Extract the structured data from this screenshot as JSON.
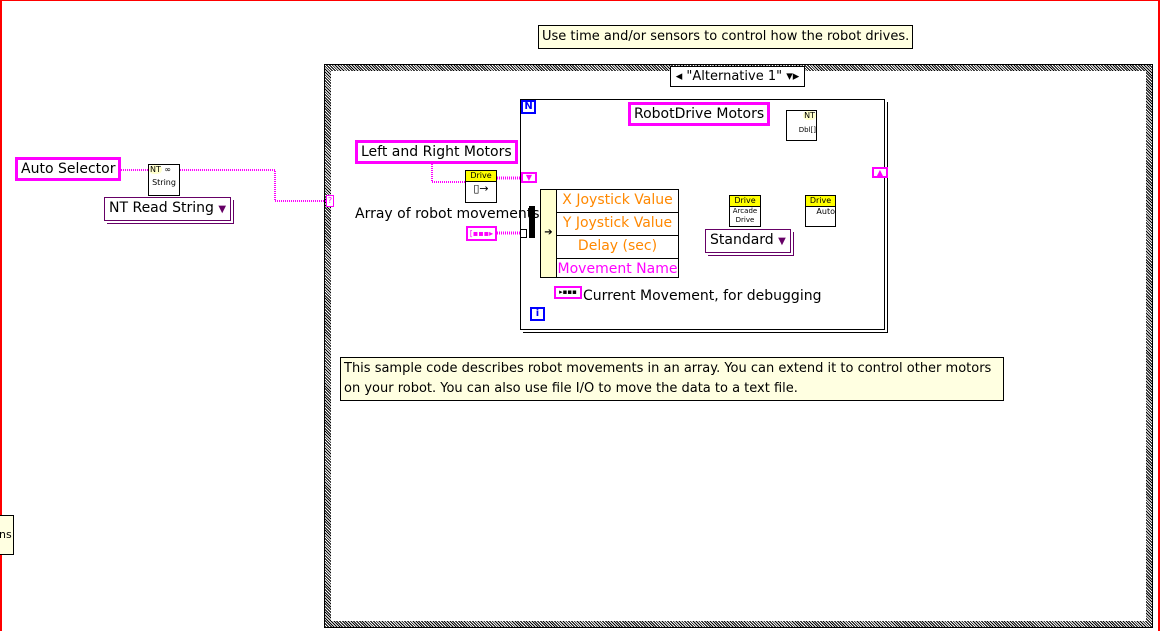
{
  "top_comment": "Use time and/or sensors to control how the robot drives.",
  "case_selector": {
    "value": "\"Alternative 1\""
  },
  "auto_selector": "Auto Selector",
  "nt_node": {
    "badge": "NT",
    "type": "String"
  },
  "nt_read_dropdown": "NT Read String",
  "left_right_motors": "Left and Right Motors",
  "robotdrive_motors": "RobotDrive Motors",
  "array_label": "Array of robot movements",
  "unbundle_rows": [
    "X Joystick Value",
    "Y Joystick Value",
    "Delay (sec)",
    "Movement Name"
  ],
  "current_movement_label": "Current Movement, for debugging",
  "drive_nodes": {
    "header": "Drive",
    "arcade": "Arcade Drive",
    "auto": "Auto"
  },
  "nt_dbl": {
    "badge": "NT",
    "type": "Dbl[]"
  },
  "standard_dropdown": "Standard",
  "loop_count": "N",
  "loop_index": "i",
  "description": "This sample code describes robot movements in an array. You can extend it to control other motors on your robot. You can also use file I/O to move the data to a text file.",
  "partial_note": "ns",
  "colors": {
    "string_wire": "#ff00ff",
    "double_wire": "#ff8000",
    "note_bg": "#ffffe1",
    "loop_terminal": "#0000ff"
  }
}
